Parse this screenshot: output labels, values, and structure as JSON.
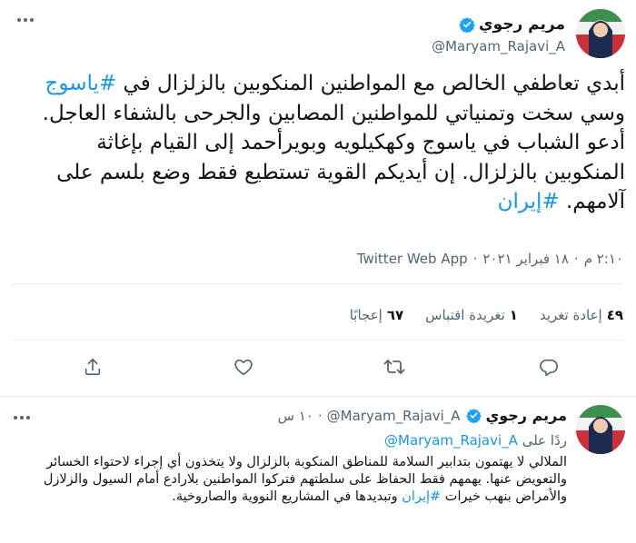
{
  "main_tweet": {
    "author": {
      "display_name": "مریم رجوي",
      "handle": "@Maryam_Rajavi_A",
      "verified": true
    },
    "text": {
      "part1": "أبدي تعاطفي الخالص مع المواطنين المنكوبين بالزلزال في ",
      "hashtag1": "#ياسوج",
      "part2": " وسي سخت وتمنياتي للمواطنين المصابين والجرحى بالشفاء العاجل. أدعو الشباب في ياسوج وكهكيلويه وبويرأحمد إلى القيام بإغاثة المنكوبين بالزلزال. إن أيديكم القوية تستطيع فقط وضع بلسم على آلامهم. ",
      "hashtag2": "#إيران"
    },
    "time": "٢:١٠ م",
    "date": "١٨ فبراير ٢٠٢١",
    "separator": "·",
    "source": "Twitter Web App",
    "stats": {
      "retweets_count": "٤٩",
      "retweets_label": "إعادة تغريد",
      "quotes_count": "١",
      "quotes_label": "تغريدة اقتباس",
      "likes_count": "٦٧",
      "likes_label": "إعجابًا"
    },
    "actions": [
      "reply-icon",
      "retweet-icon",
      "like-icon",
      "share-icon"
    ]
  },
  "reply_tweet": {
    "author": {
      "display_name": "مریم رجوي",
      "handle": "@Maryam_Rajavi_A",
      "verified": true
    },
    "separator": "·",
    "time": "١٠ س",
    "replying_to_label": "ردًا على",
    "replying_to_handle": "@Maryam_Rajavi_A",
    "text": {
      "part1": "الملالي لا يهتمون بتدابير السلامة للمناطق المنكوبة بالزلزال ولا يتخذون أي إجراء لاحتواء الخسائر والتعويض عنها. يهمهم فقط الحفاظ على سلطتهم فتركوا المواطنين بلارادع أمام السيول والزلازل والأمراض بنهب خيرات ",
      "hashtag1": "#إيران",
      "part2": " وتبديدها في المشاريع النووية والصاروخية."
    }
  },
  "colors": {
    "link": "#1b95e0",
    "verified": "#1da1f2",
    "secondary_text": "#536471",
    "divider": "#e6ecf0"
  }
}
